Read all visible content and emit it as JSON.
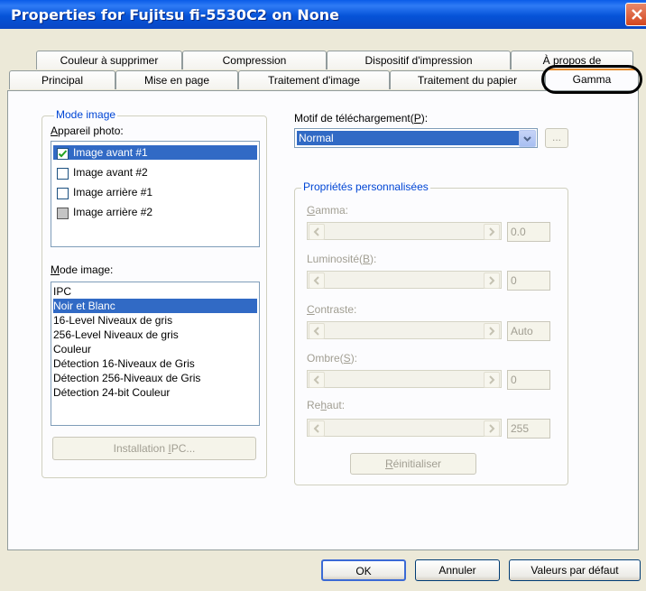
{
  "window": {
    "title": "Properties for Fujitsu fi-5530C2 on None"
  },
  "tabs_row1": [
    "Couleur à supprimer",
    "Compression",
    "Dispositif d'impression",
    "À propos de"
  ],
  "tabs_row2": [
    "Principal",
    "Mise en page",
    "Traitement d'image",
    "Traitement du papier",
    "Gamma"
  ],
  "active_tab": "Gamma",
  "mode_image_group": {
    "title": "Mode image",
    "camera_label": "Appareil photo:",
    "cameras": [
      {
        "label": "Image avant #1",
        "checked": true,
        "selected": true
      },
      {
        "label": "Image avant #2",
        "checked": false,
        "selected": false
      },
      {
        "label": "Image arrière #1",
        "checked": false,
        "selected": false
      },
      {
        "label": "Image arrière #2",
        "checked": "indeterminate",
        "selected": false
      }
    ],
    "mode_label": "Mode image:",
    "modes": [
      "IPC",
      "Noir et Blanc",
      "16-Level Niveaux de gris",
      "256-Level Niveaux de gris",
      "Couleur",
      "Détection 16-Niveaux de Gris",
      "Détection 256-Niveaux de Gris",
      "Détection 24-bit Couleur"
    ],
    "selected_mode": "Noir et Blanc",
    "ipc_button": "Installation IPC..."
  },
  "download": {
    "label": "Motif de téléchargement(P):",
    "value": "Normal",
    "browse_button": "..."
  },
  "custom": {
    "title": "Propriétés personnalisées",
    "gamma_label": "Gamma:",
    "gamma_value": "0.0",
    "luminosity_label": "Luminosité(B):",
    "luminosity_value": "0",
    "contrast_label": "Contraste:",
    "contrast_value": "Auto",
    "shadow_label": "Ombre(S):",
    "shadow_value": "0",
    "highlight_label": "Rehaut:",
    "highlight_value": "255",
    "reset_button": "Réinitialiser"
  },
  "footer": {
    "ok": "OK",
    "cancel": "Annuler",
    "defaults": "Valeurs par défaut"
  },
  "colors": {
    "accent": "#316ac5",
    "title_bar": "#0553d8",
    "group_title": "#0046d5"
  }
}
